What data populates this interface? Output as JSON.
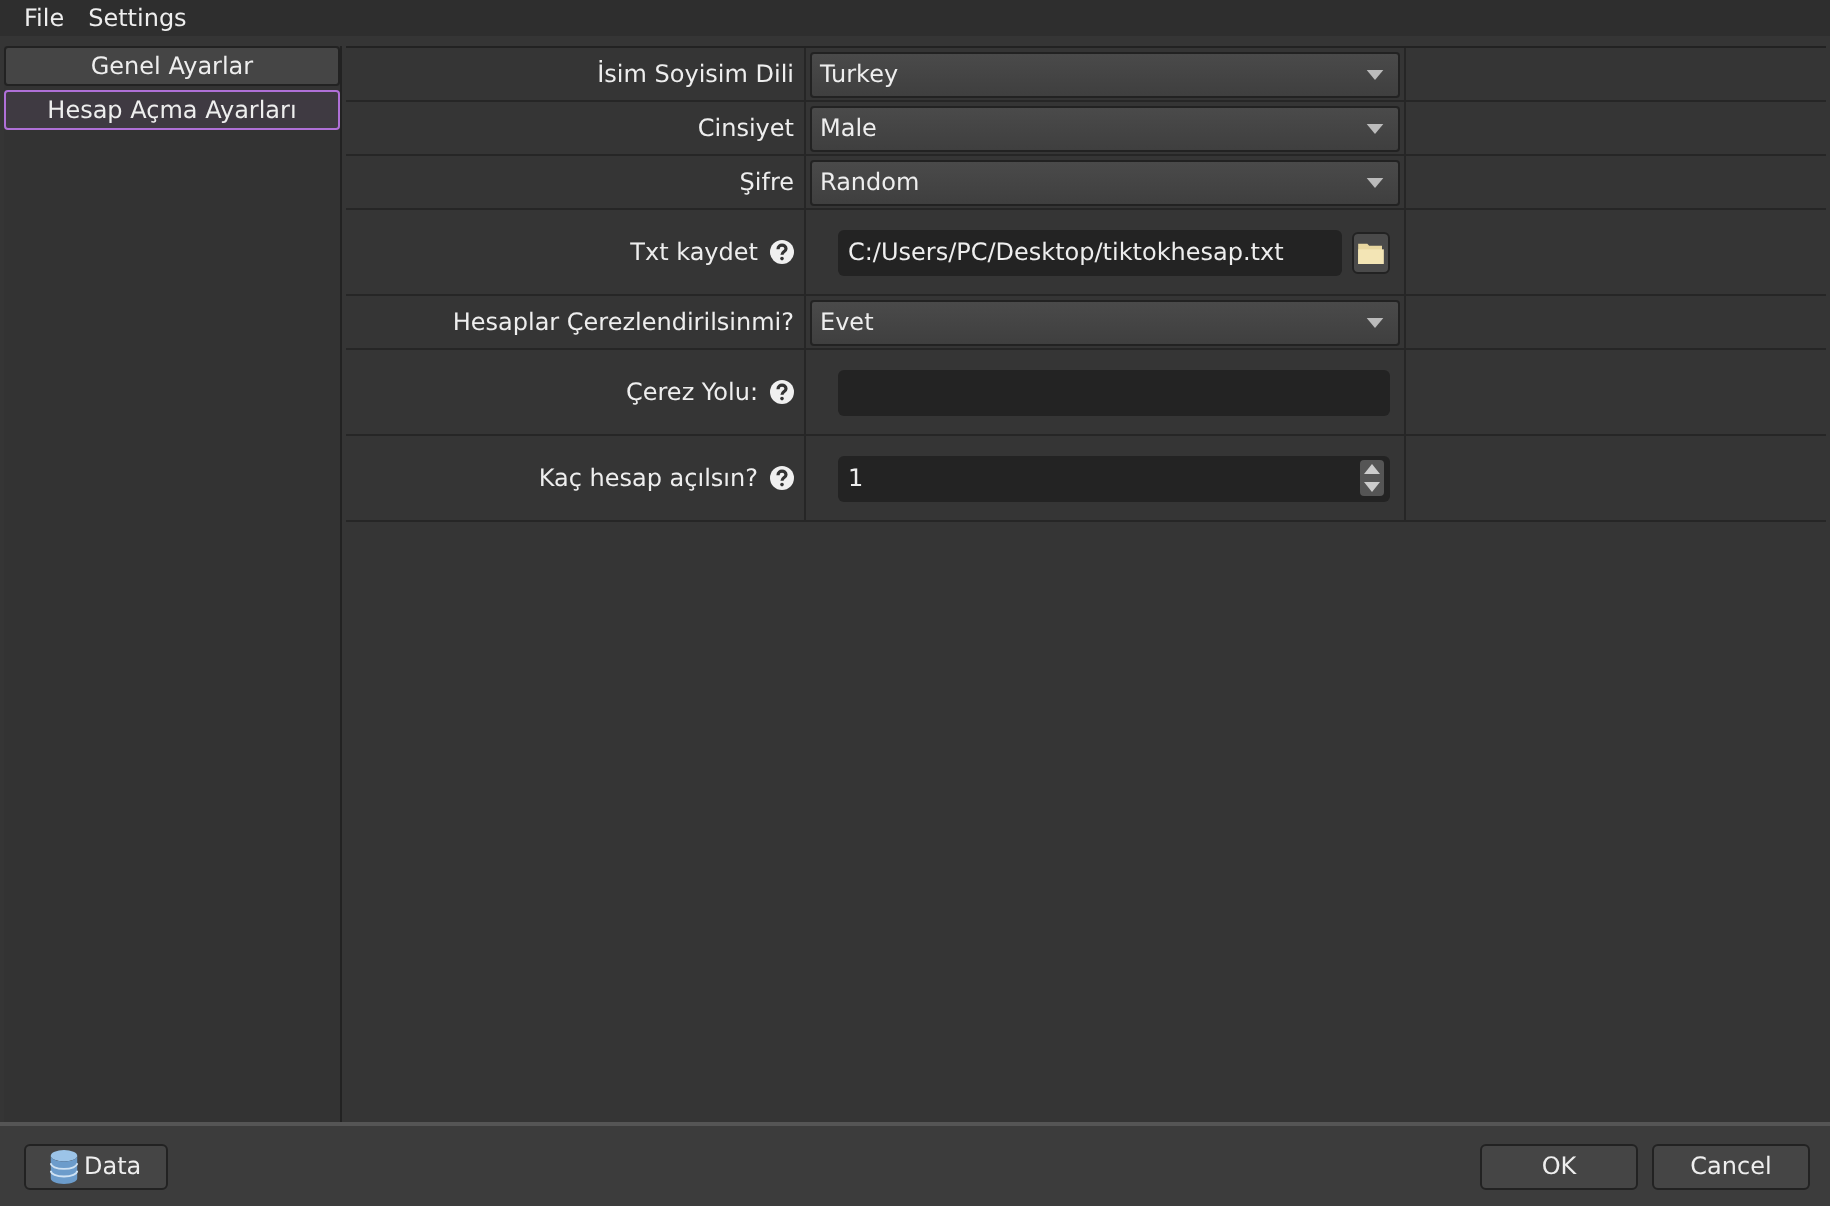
{
  "menu": [
    "File",
    "Settings"
  ],
  "sidebar": {
    "items": [
      {
        "label": "Genel Ayarlar",
        "selected": false
      },
      {
        "label": "Hesap Açma Ayarları",
        "selected": true
      }
    ]
  },
  "form": {
    "rows": [
      {
        "label": "İsim Soyisim Dili",
        "kind": "combo",
        "help": false,
        "value": "Turkey"
      },
      {
        "label": "Cinsiyet",
        "kind": "combo",
        "help": false,
        "value": "Male"
      },
      {
        "label": "Şifre",
        "kind": "combo",
        "help": false,
        "value": "Random"
      },
      {
        "label": "Txt kaydet",
        "kind": "file",
        "help": true,
        "value": "C:/Users/PC/Desktop/tiktokhesap.txt"
      },
      {
        "label": "Hesaplar Çerezlendirilsinmi?",
        "kind": "combo",
        "help": false,
        "value": "Evet"
      },
      {
        "label": "Çerez Yolu:",
        "kind": "text",
        "help": true,
        "value": ""
      },
      {
        "label": "Kaç hesap açılsın?",
        "kind": "spin",
        "help": true,
        "value": "1"
      }
    ]
  },
  "footer": {
    "data_button": "Data",
    "ok_button": "OK",
    "cancel_button": "Cancel"
  }
}
